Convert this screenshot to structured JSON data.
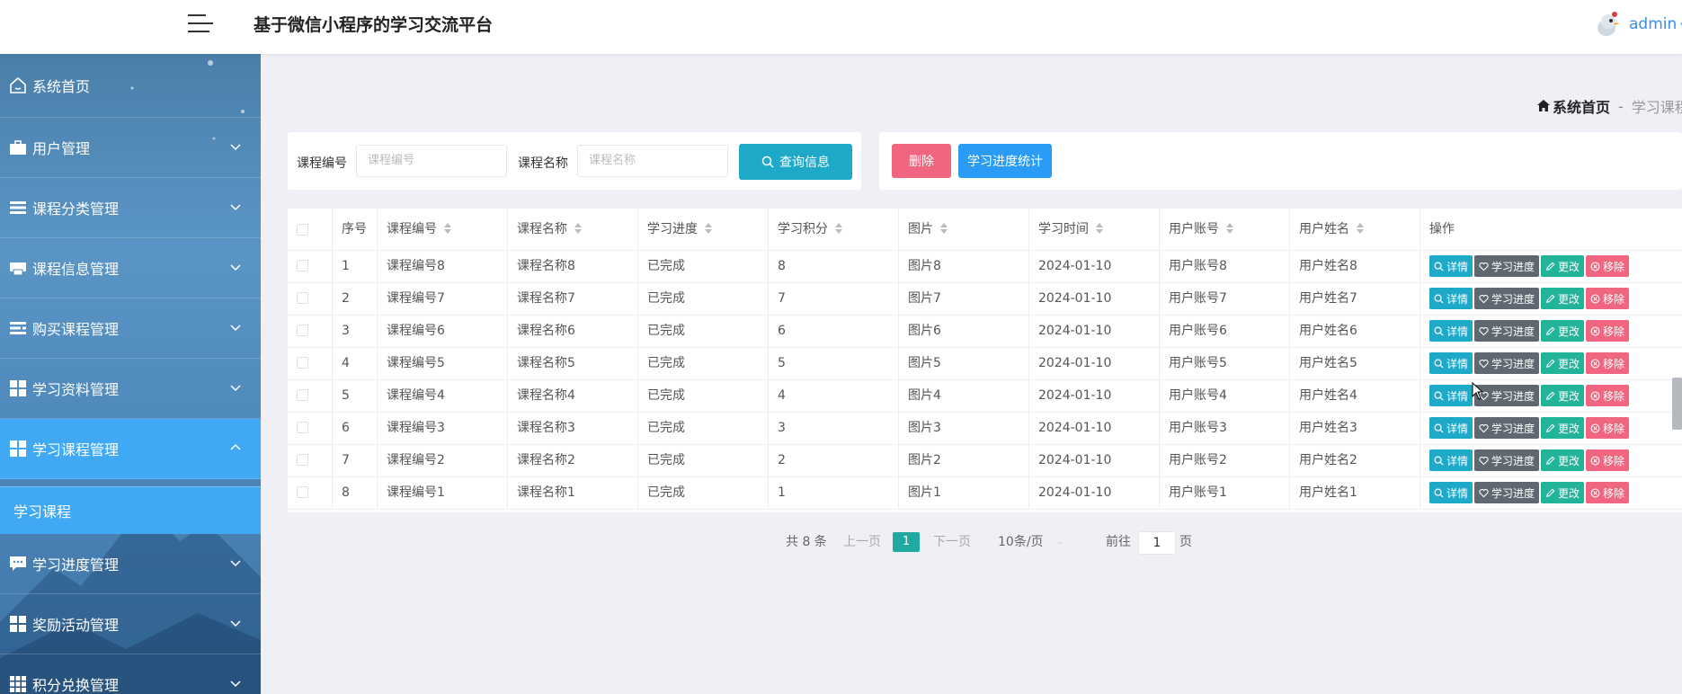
{
  "header": {
    "title": "基于微信小程序的学习交流平台",
    "user": "admin"
  },
  "sidebar": {
    "items": [
      {
        "label": "系统首页",
        "icon": "home-icon"
      },
      {
        "label": "用户管理",
        "icon": "briefcase-icon"
      },
      {
        "label": "课程分类管理",
        "icon": "list-icon"
      },
      {
        "label": "课程信息管理",
        "icon": "printer-icon"
      },
      {
        "label": "购买课程管理",
        "icon": "list-alt-icon"
      },
      {
        "label": "学习资料管理",
        "icon": "grid-icon"
      },
      {
        "label": "学习课程管理",
        "icon": "grid-icon"
      },
      {
        "label": "学习进度管理",
        "icon": "comment-icon"
      },
      {
        "label": "奖励活动管理",
        "icon": "grid-icon"
      },
      {
        "label": "积分兑换管理",
        "icon": "grid-small-icon"
      }
    ],
    "submenu": {
      "label": "学习课程"
    }
  },
  "breadcrumb": {
    "home": "系统首页",
    "separator": "-",
    "current": "学习课程"
  },
  "search": {
    "label1": "课程编号",
    "placeholder1": "课程编号",
    "label2": "课程名称",
    "placeholder2": "课程名称",
    "query_button": "查询信息"
  },
  "actions": {
    "delete": "删除",
    "stats": "学习进度统计"
  },
  "table": {
    "headers": {
      "no": "序号",
      "code": "课程编号",
      "name": "课程名称",
      "progress": "学习进度",
      "points": "学习积分",
      "image": "图片",
      "time": "学习时间",
      "account": "用户账号",
      "username": "用户姓名",
      "ops": "操作"
    },
    "row_buttons": {
      "detail": "详情",
      "progress": "学习进度",
      "edit": "更改",
      "remove": "移除"
    },
    "rows": [
      {
        "no": "1",
        "code": "课程编号8",
        "name": "课程名称8",
        "progress": "已完成",
        "points": "8",
        "image": "图片8",
        "time": "2024-01-10",
        "account": "用户账号8",
        "username": "用户姓名8"
      },
      {
        "no": "2",
        "code": "课程编号7",
        "name": "课程名称7",
        "progress": "已完成",
        "points": "7",
        "image": "图片7",
        "time": "2024-01-10",
        "account": "用户账号7",
        "username": "用户姓名7"
      },
      {
        "no": "3",
        "code": "课程编号6",
        "name": "课程名称6",
        "progress": "已完成",
        "points": "6",
        "image": "图片6",
        "time": "2024-01-10",
        "account": "用户账号6",
        "username": "用户姓名6"
      },
      {
        "no": "4",
        "code": "课程编号5",
        "name": "课程名称5",
        "progress": "已完成",
        "points": "5",
        "image": "图片5",
        "time": "2024-01-10",
        "account": "用户账号5",
        "username": "用户姓名5"
      },
      {
        "no": "5",
        "code": "课程编号4",
        "name": "课程名称4",
        "progress": "已完成",
        "points": "4",
        "image": "图片4",
        "time": "2024-01-10",
        "account": "用户账号4",
        "username": "用户姓名4"
      },
      {
        "no": "6",
        "code": "课程编号3",
        "name": "课程名称3",
        "progress": "已完成",
        "points": "3",
        "image": "图片3",
        "time": "2024-01-10",
        "account": "用户账号3",
        "username": "用户姓名3"
      },
      {
        "no": "7",
        "code": "课程编号2",
        "name": "课程名称2",
        "progress": "已完成",
        "points": "2",
        "image": "图片2",
        "time": "2024-01-10",
        "account": "用户账号2",
        "username": "用户姓名2"
      },
      {
        "no": "8",
        "code": "课程编号1",
        "name": "课程名称1",
        "progress": "已完成",
        "points": "1",
        "image": "图片1",
        "time": "2024-01-10",
        "account": "用户账号1",
        "username": "用户姓名1"
      }
    ]
  },
  "pagination": {
    "total": "共 8 条",
    "prev": "上一页",
    "current": "1",
    "next": "下一页",
    "page_size": "10条/页",
    "goto_label": "前往",
    "goto_value": "1",
    "page_suffix": "页"
  },
  "colors": {
    "sidebar_active": "#3fa9f5",
    "detail": "#1fa9c9",
    "progress": "#5f6771",
    "edit": "#22b499",
    "remove": "#f0657f"
  }
}
